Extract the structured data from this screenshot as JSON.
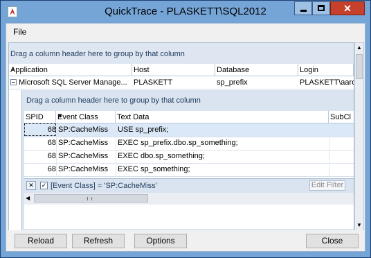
{
  "window": {
    "title": "QuickTrace - PLASKETT\\SQL2012"
  },
  "menu": {
    "file": "File"
  },
  "grid": {
    "group_hint": "Drag a column header here to group by that column",
    "columns": [
      "Application",
      "Host",
      "Database",
      "Login"
    ],
    "master_row": {
      "application": "Microsoft SQL Server Manage...",
      "host": "PLASKETT",
      "database": "sp_prefix",
      "login": "PLASKETT\\aaro"
    }
  },
  "detail": {
    "group_hint": "Drag a column header here to group by that column",
    "columns": [
      "SPID",
      "Event Class",
      "Text Data",
      "SubCl"
    ],
    "rows": [
      {
        "spid": "68",
        "event_class": "SP:CacheMiss",
        "text_data": "USE sp_prefix;"
      },
      {
        "spid": "68",
        "event_class": "SP:CacheMiss",
        "text_data": "EXEC sp_prefix.dbo.sp_something;"
      },
      {
        "spid": "68",
        "event_class": "SP:CacheMiss",
        "text_data": "EXEC dbo.sp_something;"
      },
      {
        "spid": "68",
        "event_class": "SP:CacheMiss",
        "text_data": "EXEC sp_something;"
      }
    ],
    "filter": {
      "close_glyph": "✕",
      "checked": "✓",
      "text": "[Event Class] = 'SP:CacheMiss'",
      "edit_label": "Edit Filter"
    }
  },
  "buttons": {
    "reload": "Reload",
    "refresh": "Refresh",
    "options": "Options",
    "close": "Close"
  },
  "colors": {
    "titlebar": "#75a5d6",
    "close_button": "#c7402c",
    "selected_row": "#dbe8f7"
  }
}
